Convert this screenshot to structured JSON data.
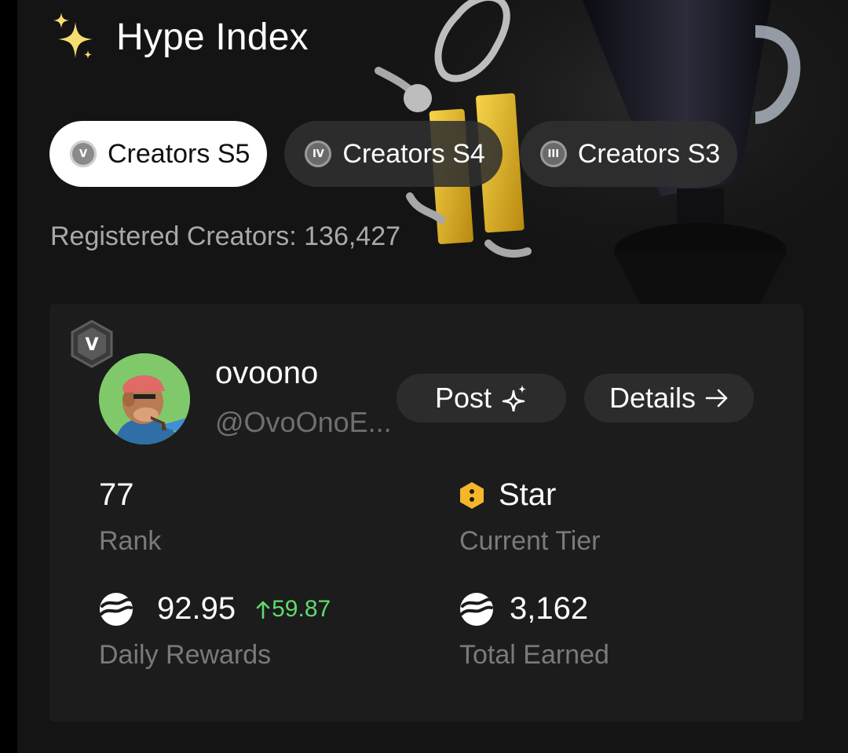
{
  "header": {
    "title": "Hype Index",
    "icon": "sparkle-icon"
  },
  "tabs": [
    {
      "label": "Creators S5",
      "badge": "V",
      "active": true
    },
    {
      "label": "Creators S4",
      "badge": "IV",
      "active": false
    },
    {
      "label": "Creators S3",
      "badge": "III",
      "active": false
    }
  ],
  "registered": "Registered Creators: 136,427",
  "card": {
    "season_badge": "V",
    "username": "ovoono",
    "handle": "@OvoOnoE...",
    "post_label": "Post",
    "details_label": "Details",
    "stats": {
      "rank_value": "77",
      "rank_label": "Rank",
      "tier_value": "Star",
      "tier_label": "Current Tier",
      "daily_value": "92.95",
      "daily_delta": "59.87",
      "daily_label": "Daily Rewards",
      "total_value": "3,162",
      "total_label": "Total Earned"
    }
  },
  "colors": {
    "background": "#141414",
    "card": "#1c1c1c",
    "delta_green": "#5fdb6b",
    "tier_gold": "#f5b729",
    "muted_text": "#7a7a7a"
  }
}
